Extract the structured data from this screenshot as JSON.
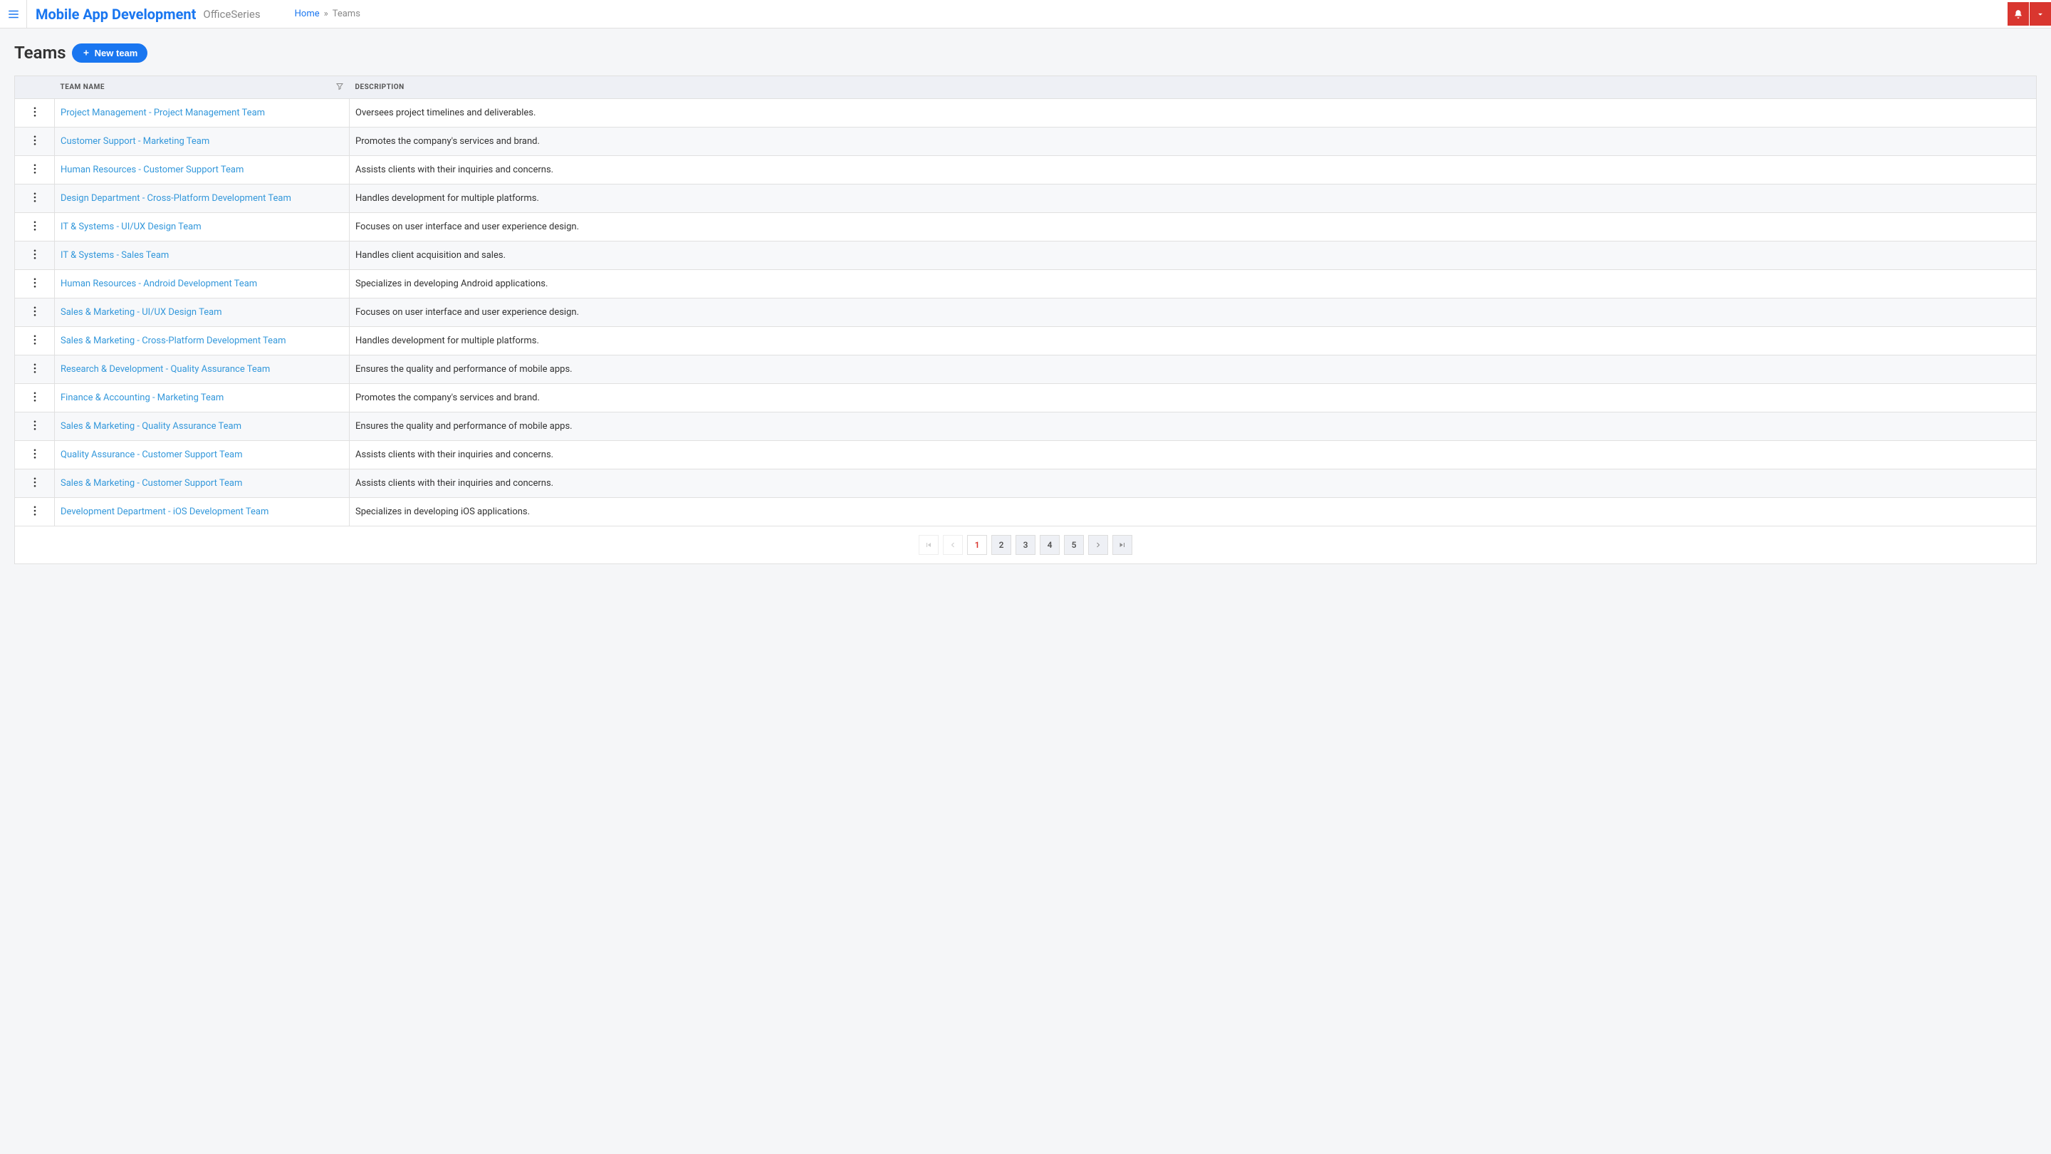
{
  "header": {
    "app_title": "Mobile App Development",
    "app_subtitle": "OfficeSeries",
    "breadcrumb_home": "Home",
    "breadcrumb_current": "Teams"
  },
  "page": {
    "title": "Teams",
    "new_button": "New team"
  },
  "table": {
    "columns": {
      "name": "Team Name",
      "description": "Description"
    },
    "rows": [
      {
        "name": "Project Management - Project Management Team",
        "description": "Oversees project timelines and deliverables."
      },
      {
        "name": "Customer Support - Marketing Team",
        "description": "Promotes the company's services and brand."
      },
      {
        "name": "Human Resources - Customer Support Team",
        "description": "Assists clients with their inquiries and concerns."
      },
      {
        "name": "Design Department - Cross-Platform Development Team",
        "description": "Handles development for multiple platforms."
      },
      {
        "name": "IT & Systems - UI/UX Design Team",
        "description": "Focuses on user interface and user experience design."
      },
      {
        "name": "IT & Systems - Sales Team",
        "description": "Handles client acquisition and sales."
      },
      {
        "name": "Human Resources - Android Development Team",
        "description": "Specializes in developing Android applications."
      },
      {
        "name": "Sales & Marketing - UI/UX Design Team",
        "description": "Focuses on user interface and user experience design."
      },
      {
        "name": "Sales & Marketing - Cross-Platform Development Team",
        "description": "Handles development for multiple platforms."
      },
      {
        "name": "Research & Development - Quality Assurance Team",
        "description": "Ensures the quality and performance of mobile apps."
      },
      {
        "name": "Finance & Accounting - Marketing Team",
        "description": "Promotes the company's services and brand."
      },
      {
        "name": "Sales & Marketing - Quality Assurance Team",
        "description": "Ensures the quality and performance of mobile apps."
      },
      {
        "name": "Quality Assurance - Customer Support Team",
        "description": "Assists clients with their inquiries and concerns."
      },
      {
        "name": "Sales & Marketing - Customer Support Team",
        "description": "Assists clients with their inquiries and concerns."
      },
      {
        "name": "Development Department - iOS Development Team",
        "description": "Specializes in developing iOS applications."
      }
    ]
  },
  "pagination": {
    "pages": [
      "1",
      "2",
      "3",
      "4",
      "5"
    ],
    "current": "1"
  }
}
